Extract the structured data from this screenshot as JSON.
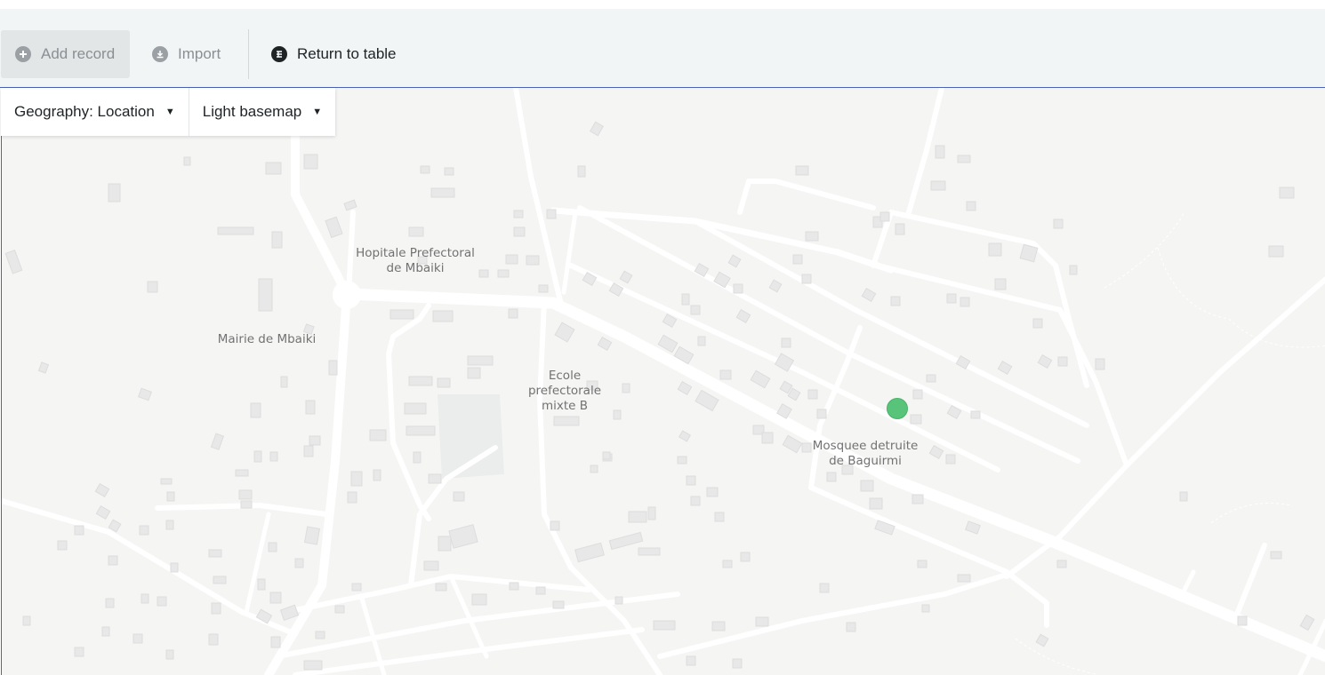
{
  "toolbar": {
    "add_record": "Add record",
    "import": "Import",
    "return_to_table": "Return to table"
  },
  "map_controls": {
    "geography": "Geography: Location",
    "basemap": "Light basemap"
  },
  "map": {
    "labels": {
      "hospital_line1": "Hopitale Prefectoral",
      "hospital_line2": "de Mbaiki",
      "mairie": "Mairie de Mbaiki",
      "ecole_line1": "Ecole prefectorale",
      "ecole_line2": "mixte B",
      "mosquee_line1": "Mosquee detruite",
      "mosquee_line2": "de Baguirmi"
    },
    "marker_color": "#58c47a",
    "background_color": "#f5f5f4",
    "road_color": "#ffffff",
    "building_color": "#e6e6e6"
  },
  "colors": {
    "accent_border": "#4a63b8",
    "toolbar_bg": "#f2f5f5"
  }
}
